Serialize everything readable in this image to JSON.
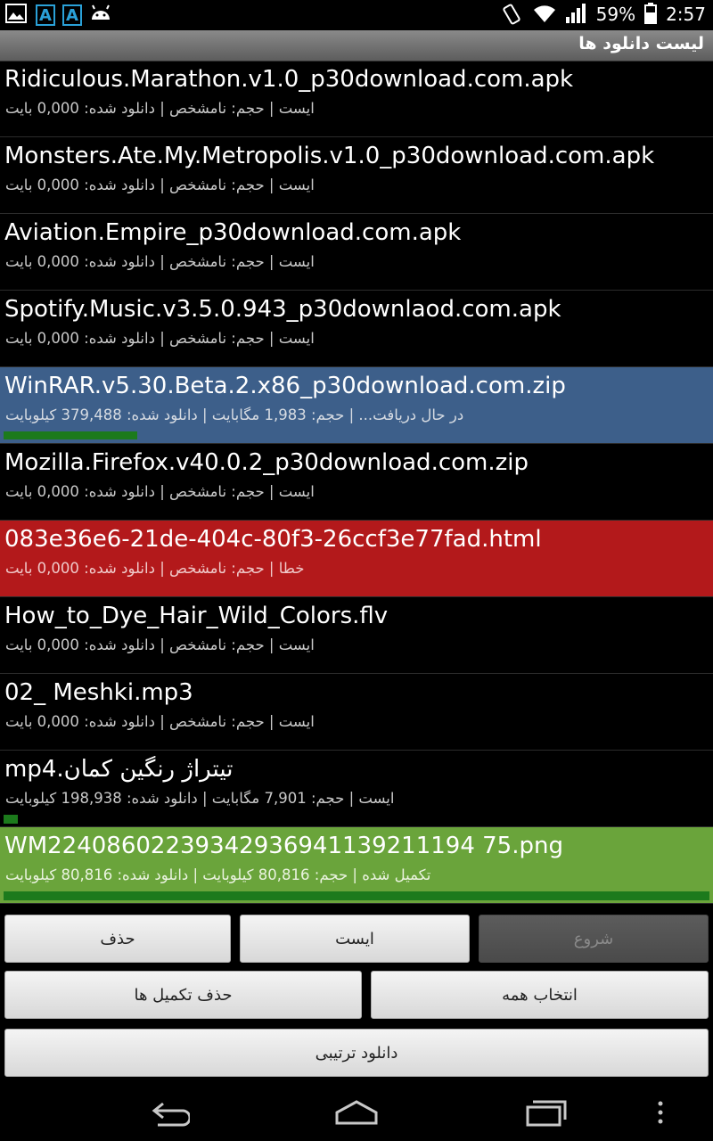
{
  "status_bar": {
    "battery": "59%",
    "time": "2:57",
    "left_icons": [
      "image-icon",
      "a-icon",
      "a-icon",
      "android-icon"
    ],
    "right_icons": [
      "rotate-icon",
      "wifi-icon",
      "signal-icon",
      "battery-icon"
    ]
  },
  "title": "لیست دانلود ها",
  "downloads": [
    {
      "name": "Ridiculous.Marathon.v1.0_p30download.com.apk",
      "info": "ایست | حجم:  نامشخص | دانلود شده: 0,000 بایت",
      "state": "stopped"
    },
    {
      "name": "Monsters.Ate.My.Metropolis.v1.0_p30download.com.apk",
      "info": "ایست | حجم:  نامشخص | دانلود شده: 0,000 بایت",
      "state": "stopped"
    },
    {
      "name": "Aviation.Empire_p30download.com.apk",
      "info": "ایست | حجم:  نامشخص | دانلود شده: 0,000 بایت",
      "state": "stopped"
    },
    {
      "name": "Spotify.Music.v3.5.0.943_p30downlaod.com.apk",
      "info": "ایست | حجم:  نامشخص | دانلود شده: 0,000 بایت",
      "state": "stopped"
    },
    {
      "name": "WinRAR.v5.30.Beta.2.x86_p30download.com.zip",
      "info": "در حال دریافت... | حجم: 1,983 مگابایت | دانلود شده: 379,488 کیلوبایت",
      "state": "downloading",
      "progress": 0.19
    },
    {
      "name": "Mozilla.Firefox.v40.0.2_p30download.com.zip",
      "info": "ایست | حجم:  نامشخص | دانلود شده: 0,000 بایت",
      "state": "stopped"
    },
    {
      "name": "083e36e6-21de-404c-80f3-26ccf3e77fad.html",
      "info": "خطا | حجم:  نامشخص | دانلود شده: 0,000 بایت",
      "state": "error"
    },
    {
      "name": "How_to_Dye_Hair_Wild_Colors.flv",
      "info": "ایست | حجم:  نامشخص | دانلود شده: 0,000 بایت",
      "state": "stopped"
    },
    {
      "name": "02_ Meshki.mp3",
      "info": "ایست | حجم:  نامشخص | دانلود شده: 0,000 بایت",
      "state": "stopped"
    },
    {
      "name": "تیتراژ رنگین کمان.mp4",
      "info": "ایست | حجم: 7,901 مگابایت | دانلود شده: 198,938 کیلوبایت",
      "state": "stopped",
      "progress": 0.02
    },
    {
      "name": "WM22408602239342936941139211194 75.png",
      "info": "تکمیل شده | حجم: 80,816 کیلوبایت | دانلود شده: 80,816 کیلوبایت",
      "state": "complete",
      "progress": 1.0
    }
  ],
  "buttons": {
    "start": "شروع",
    "stop": "ایست",
    "delete": "حذف",
    "select_all": "انتخاب همه",
    "delete_completed": "حذف تکمیل ها",
    "sequential_download": "دانلود ترتیبی"
  },
  "nav": [
    "back-icon",
    "home-icon",
    "recent-apps-icon",
    "menu-icon"
  ],
  "colors": {
    "downloading": "#3d5f8a",
    "error": "#b3191b",
    "complete": "#6aa43b",
    "progress": "#1c7a1c"
  }
}
